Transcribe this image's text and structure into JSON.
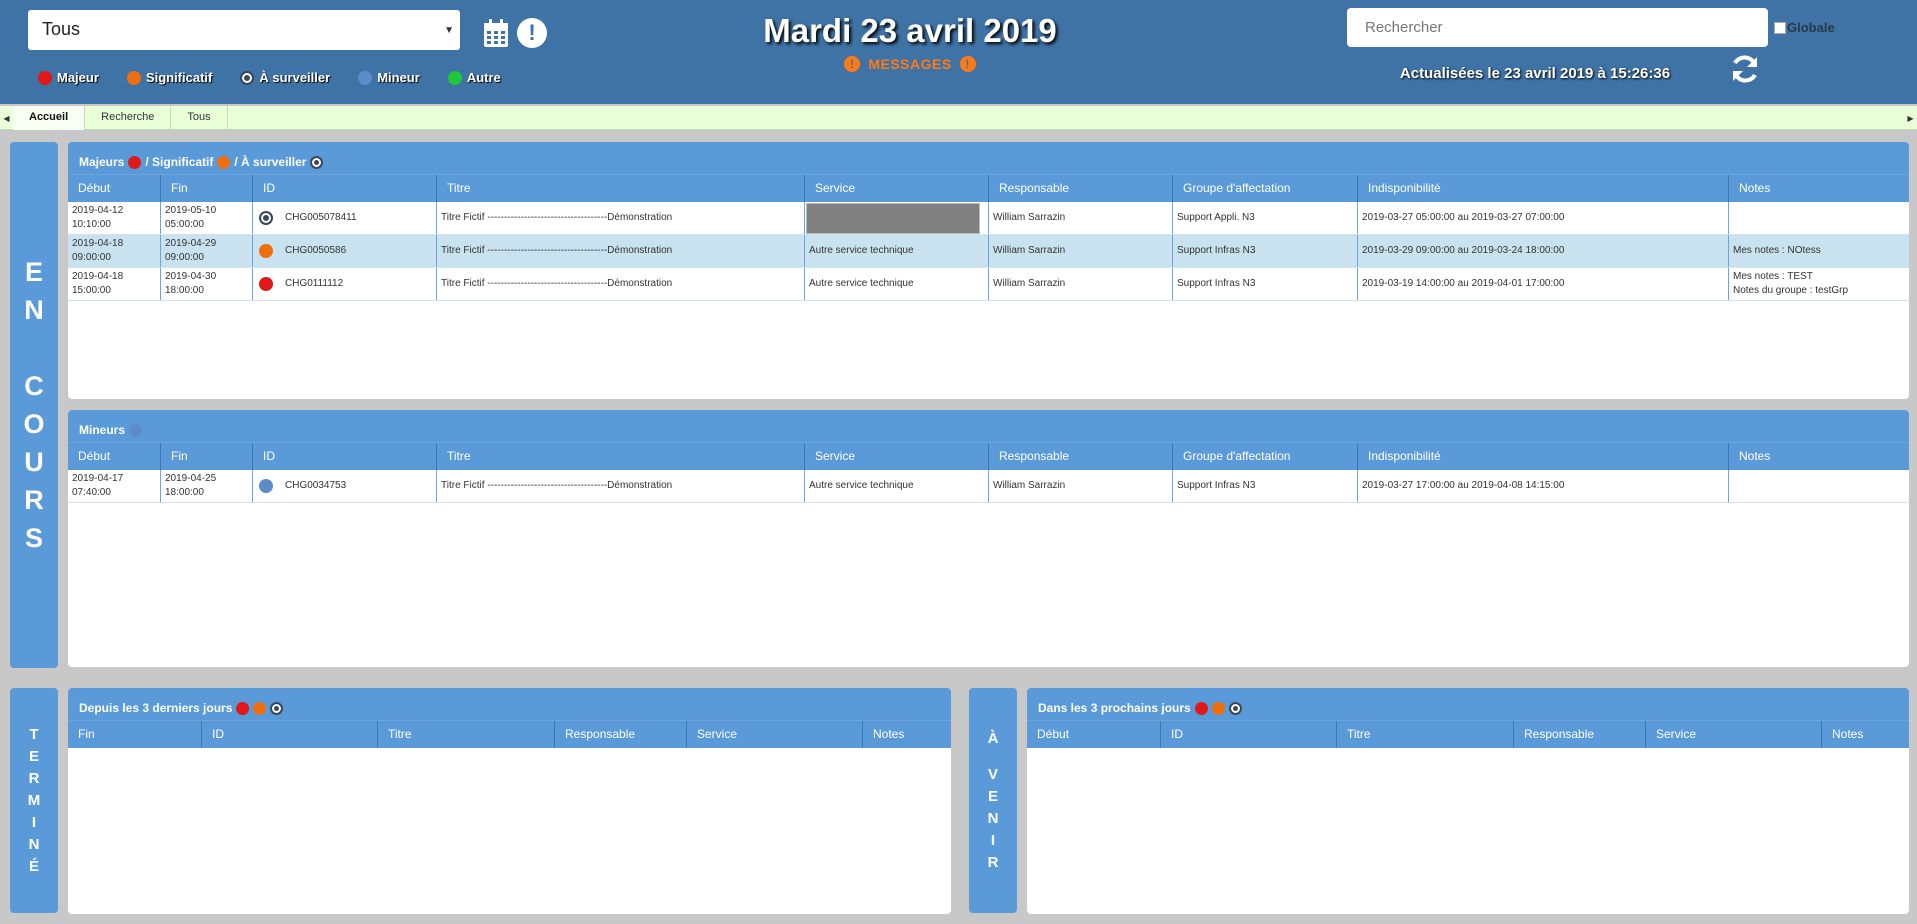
{
  "header": {
    "filter_value": "Tous",
    "date_title": "Mardi 23 avril 2019",
    "messages_label": "MESSAGES",
    "search_placeholder": "Rechercher",
    "globale_label": "Globale",
    "updated_text": "Actualisées le 23 avril 2019 à 15:26:36",
    "legend": [
      {
        "label": "Majeur",
        "color": "#e01818"
      },
      {
        "label": "Significatif",
        "color": "#f06e0e"
      },
      {
        "label": "À surveiller",
        "icon": "target-icon"
      },
      {
        "label": "Mineur",
        "color": "#5a8dc8"
      },
      {
        "label": "Autre",
        "color": "#1ec83c"
      }
    ]
  },
  "tabs": [
    "Accueil",
    "Recherche",
    "Tous"
  ],
  "side_labels": {
    "en_cours": [
      "E",
      "N",
      "C",
      "O",
      "U",
      "R",
      "S"
    ],
    "termine": [
      "T",
      "E",
      "R",
      "M",
      "I",
      "N",
      "É"
    ],
    "a_venir": [
      "À",
      "V",
      "E",
      "N",
      "I",
      "R"
    ]
  },
  "majeurs_panel": {
    "title_majeurs": "Majeurs",
    "title_significatif": "/ Significatif",
    "title_surveiller": "/ À surveiller",
    "columns": [
      "Début",
      "Fin",
      "ID",
      "Titre",
      "Service",
      "Responsable",
      "Groupe d'affectation",
      "Indisponibilité",
      "Notes"
    ],
    "rows": [
      {
        "debut": [
          "2019-04-12",
          "10:10:00"
        ],
        "fin": [
          "2019-05-10",
          "05:00:00"
        ],
        "severity": "watch",
        "id": "CHG005078411",
        "titre": "Titre Fictif ------------------------------------Démonstration",
        "service": "",
        "responsable": "William Sarrazin",
        "groupe": "Support Appli. N3",
        "indispo": "2019-03-27 05:00:00 au 2019-03-27 07:00:00",
        "notes": [
          "",
          ""
        ]
      },
      {
        "debut": [
          "2019-04-18",
          "09:00:00"
        ],
        "fin": [
          "2019-04-29",
          "09:00:00"
        ],
        "severity": "orange",
        "id": "CHG0050586",
        "titre": "Titre Fictif ------------------------------------Démonstration",
        "service": "Autre service technique",
        "responsable": "William Sarrazin",
        "groupe": "Support Infras N3",
        "indispo": "2019-03-29 09:00:00 au 2019-03-24 18:00:00",
        "notes": [
          "Mes notes : NOtess",
          ""
        ]
      },
      {
        "debut": [
          "2019-04-18",
          "15:00:00"
        ],
        "fin": [
          "2019-04-30",
          "18:00:00"
        ],
        "severity": "red",
        "id": "CHG0111112",
        "titre": "Titre Fictif ------------------------------------Démonstration",
        "service": "Autre service technique",
        "responsable": "William Sarrazin",
        "groupe": "Support Infras N3",
        "indispo": "2019-03-19 14:00:00 au 2019-04-01 17:00:00",
        "notes": [
          "Mes notes : TEST",
          "Notes du groupe : testGrp"
        ]
      }
    ]
  },
  "mineurs_panel": {
    "title": "Mineurs",
    "columns": [
      "Début",
      "Fin",
      "ID",
      "Titre",
      "Service",
      "Responsable",
      "Groupe d'affectation",
      "Indisponibilité",
      "Notes"
    ],
    "rows": [
      {
        "debut": [
          "2019-04-17",
          "07:40:00"
        ],
        "fin": [
          "2019-04-25",
          "18:00:00"
        ],
        "severity": "blue",
        "id": "CHG0034753",
        "titre": "Titre Fictif ------------------------------------Démonstration",
        "service": "Autre service technique",
        "responsable": "William Sarrazin",
        "groupe": "Support Infras N3",
        "indispo": "2019-03-27 17:00:00 au 2019-04-08 14:15:00",
        "notes": [
          "",
          ""
        ]
      }
    ]
  },
  "past_panel": {
    "title": "Depuis les 3 derniers jours",
    "columns": [
      "Fin",
      "ID",
      "Titre",
      "Responsable",
      "Service",
      "Notes"
    ]
  },
  "future_panel": {
    "title": "Dans les 3 prochains jours",
    "columns": [
      "Début",
      "ID",
      "Titre",
      "Responsable",
      "Service",
      "Notes"
    ]
  },
  "colors": {
    "header_bg": "#3f73a6",
    "panel_head": "#5b9ad9",
    "tabbar_bg": "#eaffd8",
    "messages": "#ff7a14"
  }
}
